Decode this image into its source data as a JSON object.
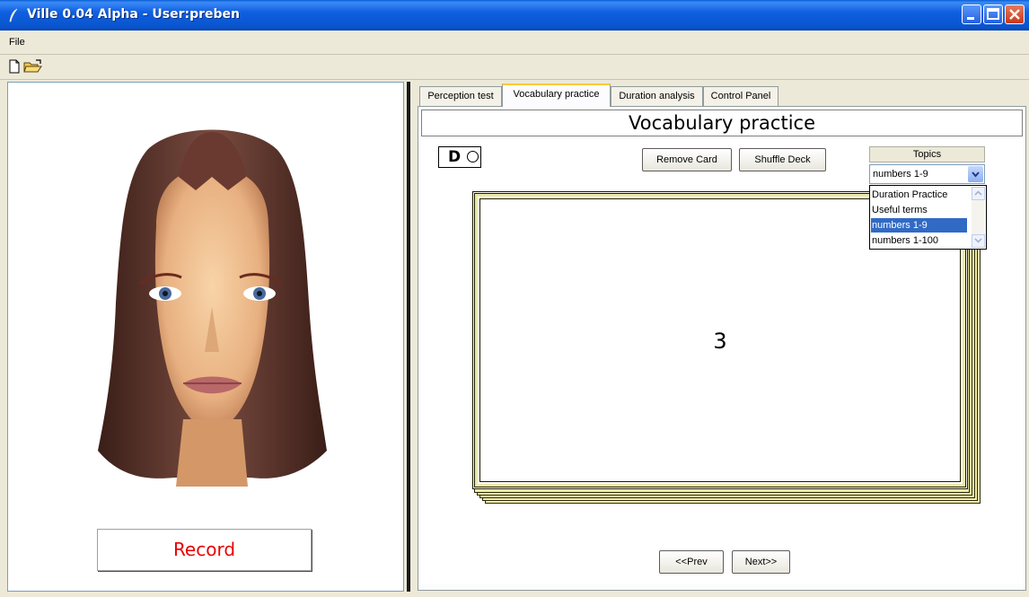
{
  "window": {
    "title": "Ville 0.04 Alpha - User:preben"
  },
  "menu": {
    "file": "File"
  },
  "toolbar": {
    "icons": [
      "new-document-icon",
      "open-folder-icon"
    ]
  },
  "left": {
    "record_label": "Record"
  },
  "tabs": [
    {
      "label": "Perception test",
      "active": false
    },
    {
      "label": "Vocabulary practice",
      "active": true
    },
    {
      "label": "Duration analysis",
      "active": false
    },
    {
      "label": "Control Panel",
      "active": false
    }
  ],
  "vocab": {
    "title": "Vocabulary practice",
    "indicator_letter": "D",
    "remove_card": "Remove Card",
    "shuffle_deck": "Shuffle Deck",
    "topics_label": "Topics",
    "topics_selected": "numbers 1-9",
    "topics_options": [
      "Duration Practice",
      "Useful terms",
      "numbers 1-9",
      "numbers 1-100"
    ],
    "card_value": "3",
    "prev": "<<Prev",
    "next": "Next>>"
  },
  "colors": {
    "record_text": "#e80000",
    "selection": "#316ac5",
    "active_tab_accent": "#ffc83c"
  }
}
